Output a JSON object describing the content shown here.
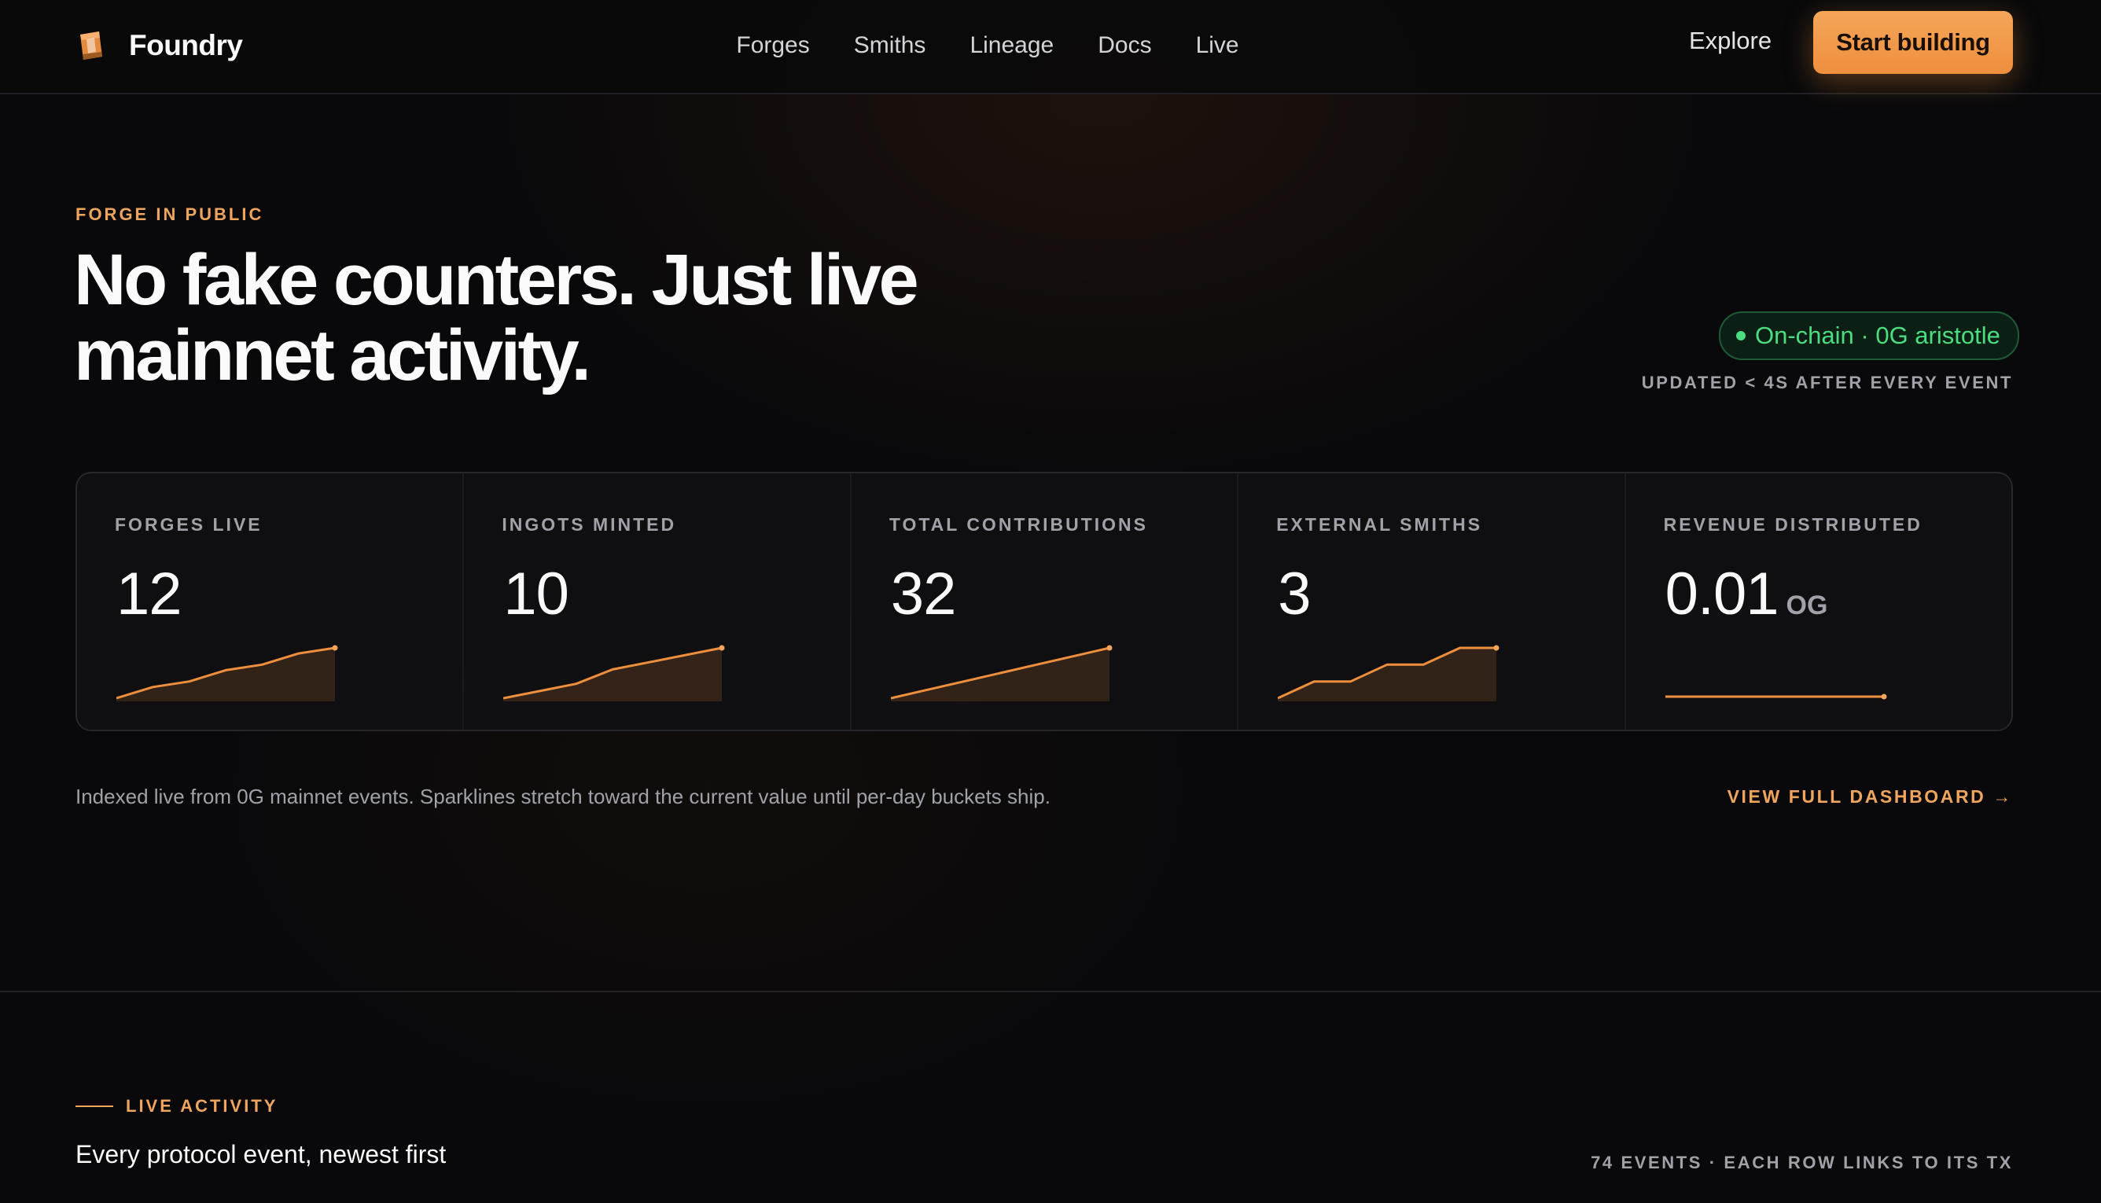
{
  "header": {
    "brand": "Foundry",
    "nav": [
      "Forges",
      "Smiths",
      "Lineage",
      "Docs",
      "Live"
    ],
    "explore": "Explore",
    "cta": "Start building"
  },
  "hero": {
    "eyebrow": "FORGE IN PUBLIC",
    "title": "No fake counters. Just live mainnet activity.",
    "chain_badge": "On-chain · 0G aristotle",
    "updated": "UPDATED < 4S AFTER EVERY EVENT"
  },
  "stats": [
    {
      "label": "FORGES LIVE",
      "value": "12",
      "unit": "",
      "spark": [
        0,
        2,
        3,
        5,
        6,
        8,
        9
      ]
    },
    {
      "label": "INGOTS MINTED",
      "value": "10",
      "unit": "",
      "spark": [
        0,
        1,
        2,
        4,
        5,
        6,
        7
      ]
    },
    {
      "label": "TOTAL CONTRIBUTIONS",
      "value": "32",
      "unit": "",
      "spark": [
        0,
        2,
        4,
        6,
        8,
        10,
        12
      ]
    },
    {
      "label": "EXTERNAL SMITHS",
      "value": "3",
      "unit": "",
      "spark": [
        0,
        1,
        1,
        2,
        2,
        3,
        3
      ]
    },
    {
      "label": "REVENUE DISTRIBUTED",
      "value": "0.01",
      "unit": "OG",
      "spark": [
        0,
        0,
        0,
        0,
        0,
        0,
        0
      ]
    }
  ],
  "footnote": "Indexed live from 0G mainnet events. Sparklines stretch toward the current value until per-day buckets ship.",
  "dashboard_link": "VIEW FULL DASHBOARD →",
  "live": {
    "eyebrow": "LIVE ACTIVITY",
    "title": "Every protocol event, newest first",
    "meta": "74 EVENTS · EACH ROW LINKS TO ITS TX"
  },
  "colors": {
    "accent": "#f0a55e",
    "cta": "#ee8f3d",
    "success": "#4ade80",
    "background": "#09090b"
  },
  "icons": {
    "brand": "ingot-logo-icon"
  }
}
